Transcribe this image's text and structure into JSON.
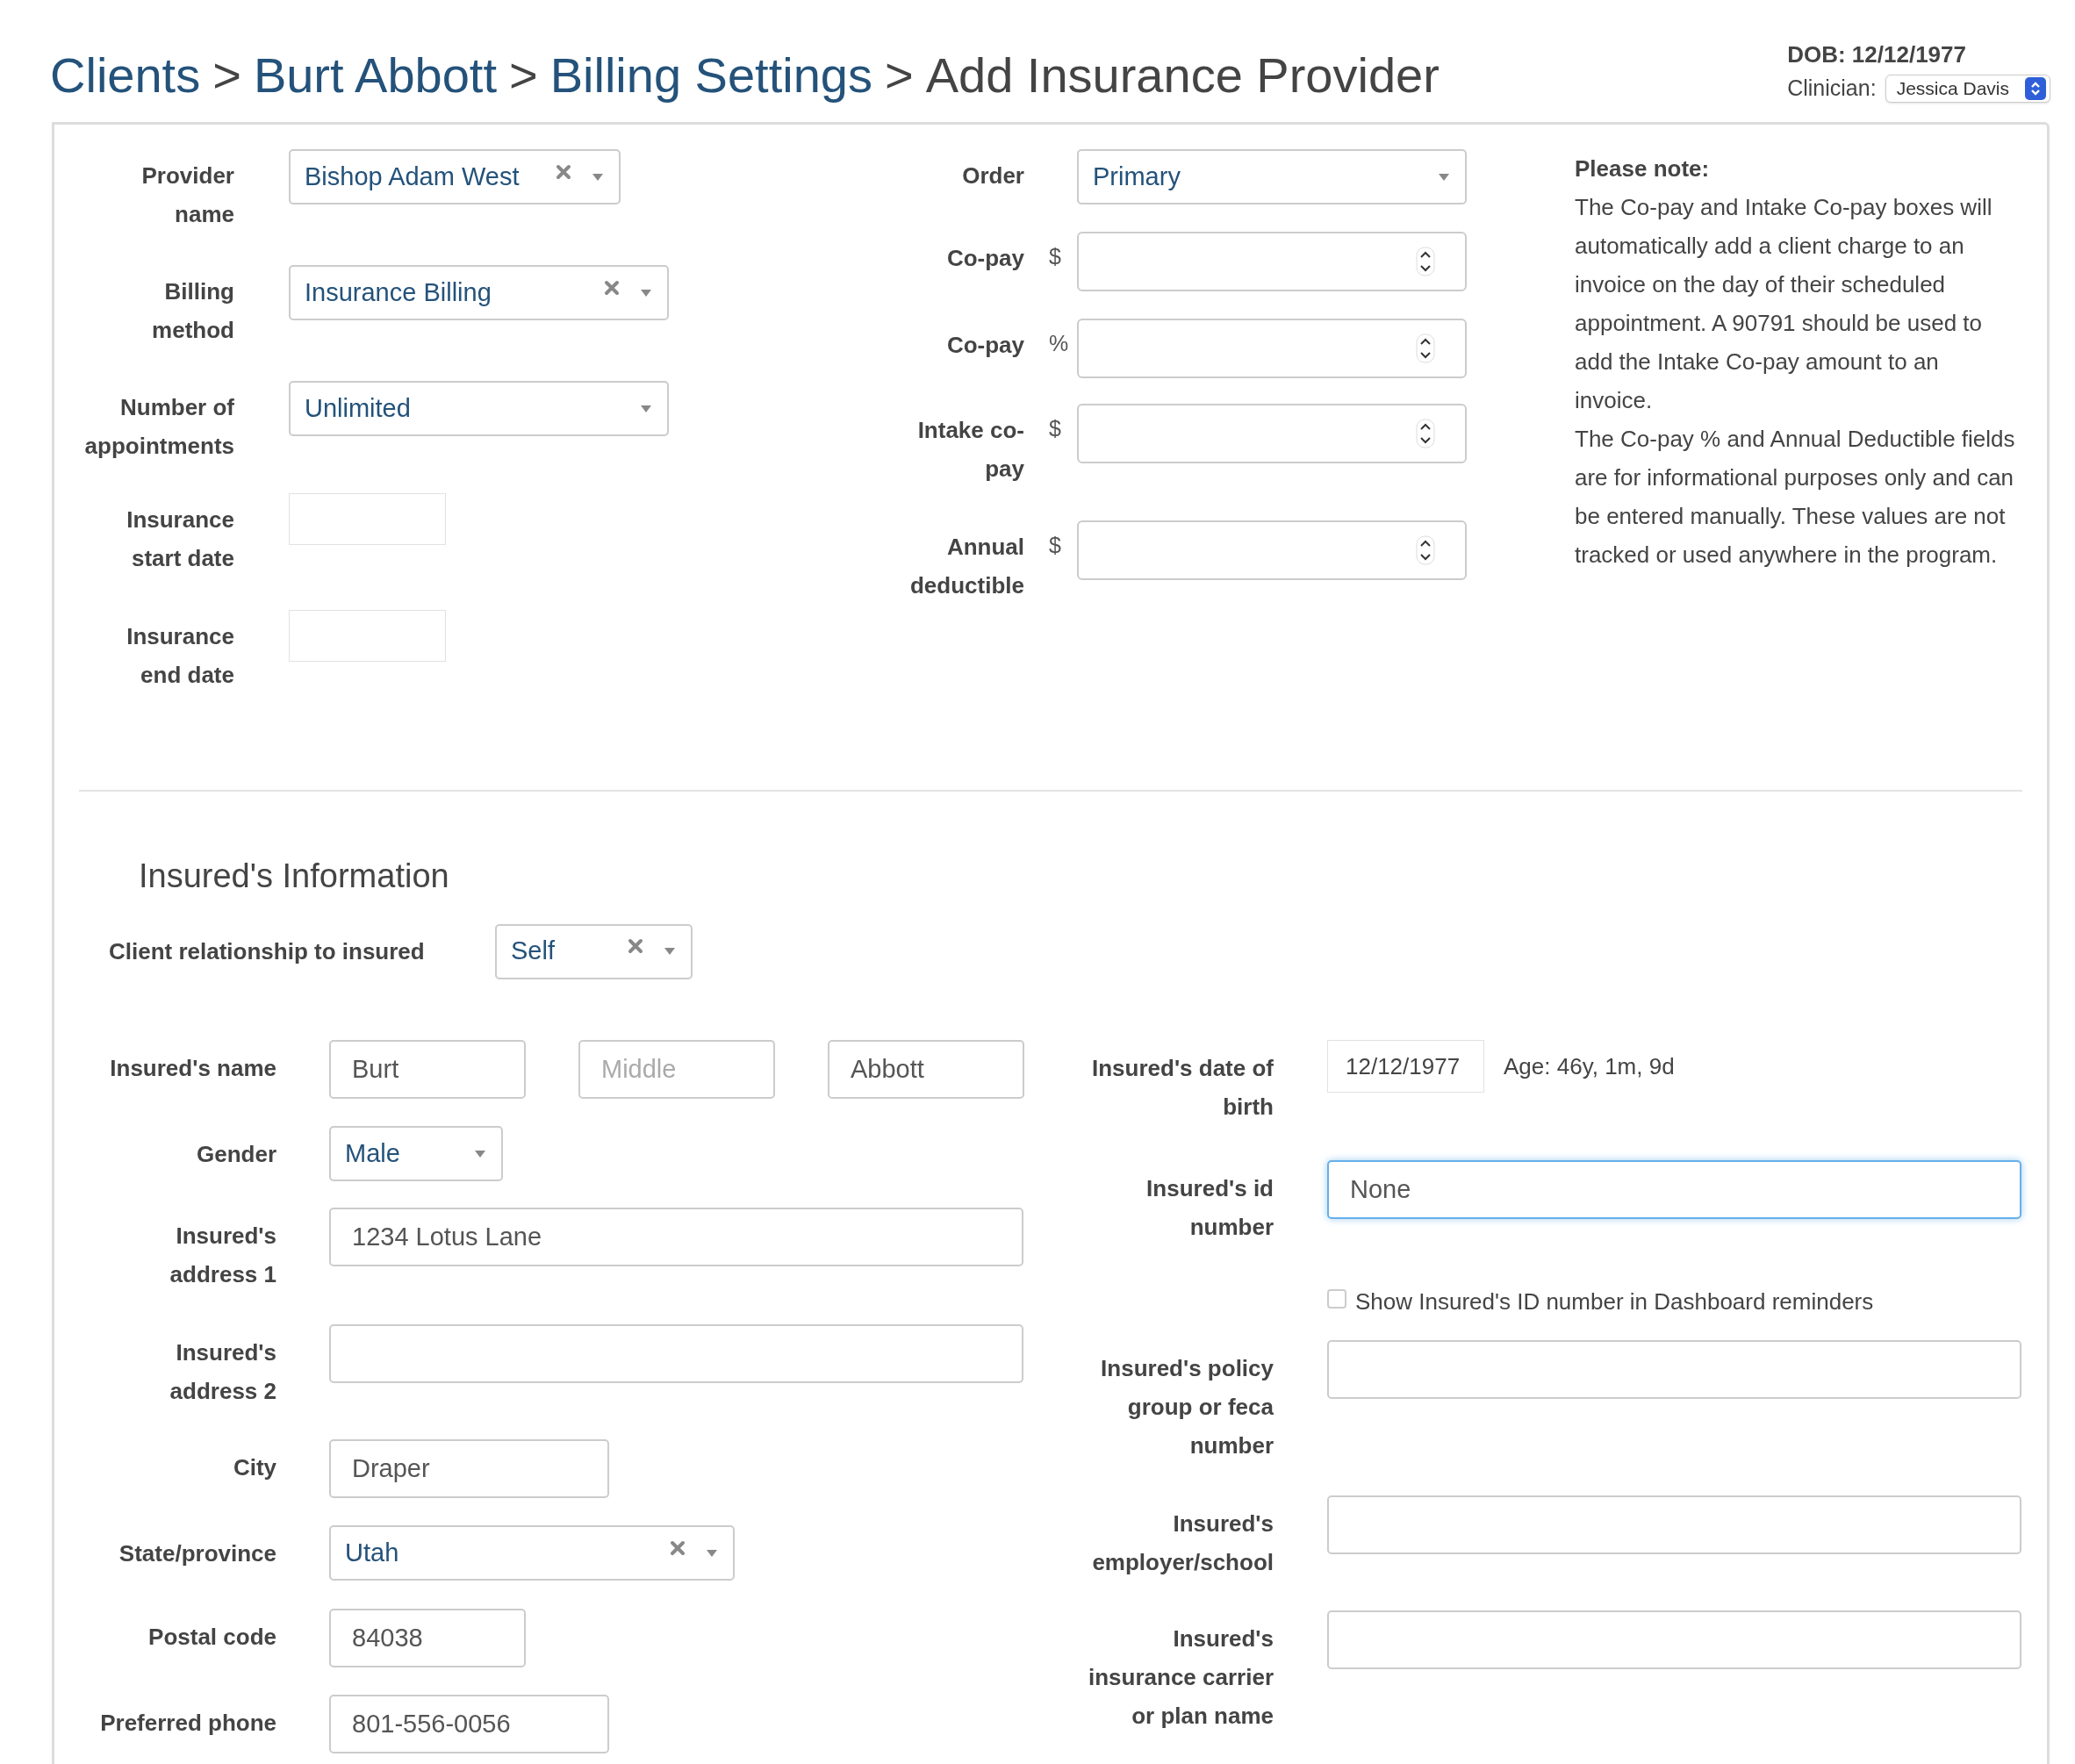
{
  "breadcrumb": [
    {
      "kind": "link",
      "text": "Clients"
    },
    {
      "kind": "separator",
      "text": ">"
    },
    {
      "kind": "link",
      "text": "Burt Abbott"
    },
    {
      "kind": "separator",
      "text": ">"
    },
    {
      "kind": "link",
      "text": "Billing Settings"
    },
    {
      "kind": "separator",
      "text": ">"
    },
    {
      "kind": "current",
      "text": "Add Insurance Provider"
    }
  ],
  "client": {
    "dob": "DOB: 12/12/1977",
    "clinician_label": "Clinician:",
    "clinician": "Jessica Davis"
  },
  "provider_fields": [
    {
      "label": "Provider name",
      "kind": "select",
      "value": "Bishop Adam West",
      "clearable": true
    },
    {
      "label": "Billing method",
      "kind": "select",
      "value": "Insurance Billing",
      "clearable": true
    },
    {
      "label": "Number of appointments",
      "kind": "select",
      "value": "Unlimited",
      "clearable": false
    },
    {
      "label": "Insurance start date",
      "kind": "date"
    },
    {
      "label": "Insurance end date",
      "kind": "date"
    }
  ],
  "amount_fields": [
    {
      "label": "Order",
      "kind": "select",
      "value": "Primary",
      "clearable": false
    },
    {
      "label": "Co-pay",
      "kind": "number",
      "unit": "$"
    },
    {
      "label": "Co-pay",
      "kind": "number",
      "unit": "%"
    },
    {
      "label": "Intake co-pay",
      "kind": "number",
      "unit": "$"
    },
    {
      "label": "Annual deductible",
      "kind": "number",
      "unit": "$"
    }
  ],
  "note": {
    "title": "Please note:",
    "paragraphs": [
      "The Co-pay and Intake Co-pay boxes will automatically add a client charge to an invoice on the day of their scheduled appointment. A 90791 should be used to add the Intake Co-pay amount to an invoice.",
      "The Co-pay % and Annual Deductible fields are for informational purposes only and can be entered manually. These values are not tracked or used anywhere in the program."
    ]
  },
  "insured": {
    "heading": "Insured's Information",
    "relationship": {
      "label": "Client relationship to insured",
      "value": "Self",
      "clearable": true
    },
    "left_fields": [
      {
        "label": "Insured's name",
        "kind": "name",
        "parts": [
          {
            "value": "Burt"
          },
          {
            "placeholder": "Middle"
          },
          {
            "value": "Abbott"
          }
        ]
      },
      {
        "label": "Gender",
        "kind": "select",
        "value": "Male",
        "clearable": false
      },
      {
        "label": "Insured's address 1",
        "kind": "text",
        "value": "1234 Lotus Lane"
      },
      {
        "label": "Insured's address 2",
        "kind": "text"
      },
      {
        "label": "City",
        "kind": "text",
        "value": "Draper"
      },
      {
        "label": "State/province",
        "kind": "select",
        "value": "Utah",
        "clearable": true
      },
      {
        "label": "Postal code",
        "kind": "text",
        "value": "84038"
      },
      {
        "label": "Preferred phone",
        "kind": "text",
        "value": "801-556-0056"
      }
    ],
    "right_fields": [
      {
        "label": "Insured's date of birth",
        "kind": "date",
        "value": "12/12/1977",
        "age": "Age: 46y, 1m, 9d"
      },
      {
        "label": "Insured's id number",
        "kind": "text",
        "value": "None",
        "focused": true
      },
      {
        "label": "Show Insured's ID number in Dashboard reminders",
        "kind": "checkbox",
        "checked": false
      },
      {
        "label": "Insured's policy group or feca number",
        "kind": "text"
      },
      {
        "label": "Insured's employer/school",
        "kind": "text"
      },
      {
        "label": "Insured's insurance carrier or plan name",
        "kind": "text"
      }
    ]
  }
}
